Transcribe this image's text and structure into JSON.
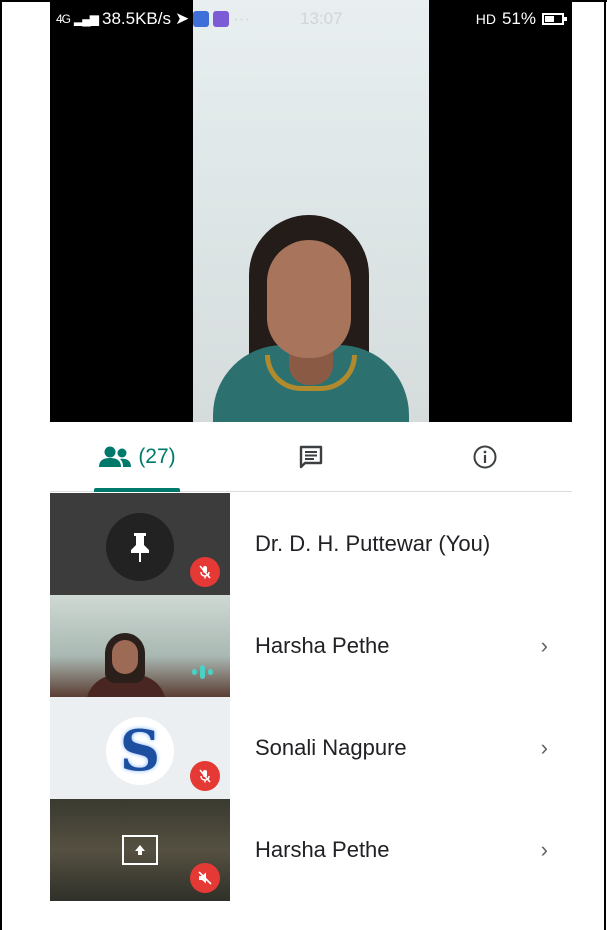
{
  "status_bar": {
    "signal_label": "4G",
    "network_speed": "38.5KB/s",
    "time": "13:07",
    "call_label": "HD",
    "battery_percent": "51%"
  },
  "tabs": {
    "people_count": "(27)",
    "active": "people"
  },
  "participants": [
    {
      "name": "Dr. D. H. Puttewar (You)",
      "avatar": "pin-icon",
      "muted": true,
      "has_chevron": false
    },
    {
      "name": "Harsha Pethe",
      "avatar": "video",
      "muted": false,
      "speaking": true,
      "has_chevron": true
    },
    {
      "name": "Sonali Nagpure",
      "avatar": "S",
      "muted": true,
      "has_chevron": true
    },
    {
      "name": "Harsha Pethe",
      "avatar": "present-icon",
      "muted": true,
      "audio_off": true,
      "has_chevron": true
    }
  ],
  "colors": {
    "accent": "#00796b",
    "mute_red": "#e53935",
    "speaking": "#4dd0c4"
  }
}
